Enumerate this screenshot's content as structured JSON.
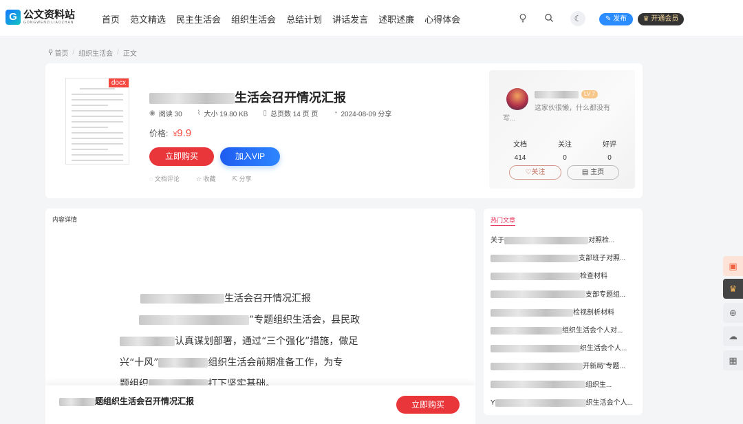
{
  "header": {
    "logo": {
      "cn": "公文资料站",
      "en": "GONGWENZILIAOZHAN"
    },
    "nav": [
      "首页",
      "范文精选",
      "民主生活会",
      "组织生活会",
      "总结计划",
      "讲话发言",
      "述职述廉",
      "心得体会"
    ],
    "publish_label": "发布",
    "vip_label": "开通会员"
  },
  "breadcrumb": [
    "首页",
    "组织生活会",
    "正文"
  ],
  "document": {
    "file_type": "docx",
    "title_visible": "生活会召开情况汇报",
    "reads_label": "阅读 30",
    "size_label": "大小 19.80 KB",
    "pages_label": "总页数 14 页 页",
    "date_label": "2024-08-09 分享",
    "price_label": "价格:",
    "price_currency": "¥",
    "price_value": "9.9",
    "buy_label": "立即购买",
    "vip_join_label": "加入VIP",
    "actions": [
      "文档评论",
      "收藏",
      "分享"
    ]
  },
  "author": {
    "level": "LV 7",
    "bio": "这家伙很懒，什么都没有写...",
    "stats": [
      {
        "label": "文档",
        "value": "414"
      },
      {
        "label": "关注",
        "value": "0"
      },
      {
        "label": "好评",
        "value": "0"
      }
    ],
    "follow_label": "♡关注",
    "home_label": "主页"
  },
  "content": {
    "header": "内容详情",
    "line1_tail": "生活会召开情况汇报",
    "line2": "”专题组织生活会，县民政",
    "line3": "认真谋划部署，通过“三个强化”措施，做足",
    "line4a": "兴“十风”",
    "line4b": "组织生活会前期准备工作，为专",
    "line5a": "题组织",
    "line5b": "打下坚实基础。",
    "bottom_title": "题组织生活会召开情况汇报",
    "bottom_buy": "立即购买"
  },
  "hot": {
    "header": "热门文章",
    "items": [
      {
        "lead": "关于",
        "tail": "对照检..."
      },
      {
        "lead": "",
        "tail": "支部班子对照..."
      },
      {
        "lead": "",
        "tail": "检查材料"
      },
      {
        "lead": "",
        "tail": "支部专题组..."
      },
      {
        "lead": "",
        "tail": "检视剖析材料"
      },
      {
        "lead": "",
        "tail": "组织生活会个人对..."
      },
      {
        "lead": "",
        "tail": "织生活会个人..."
      },
      {
        "lead": "",
        "tail": "开新局”专题..."
      },
      {
        "lead": "",
        "tail": "组织生..."
      },
      {
        "lead": "Y",
        "tail": "织生活会个人..."
      }
    ]
  },
  "colors": {
    "accent_red": "#e9363a",
    "vip_blue": "#2e86ff",
    "hot_pink": "#e8345b"
  }
}
